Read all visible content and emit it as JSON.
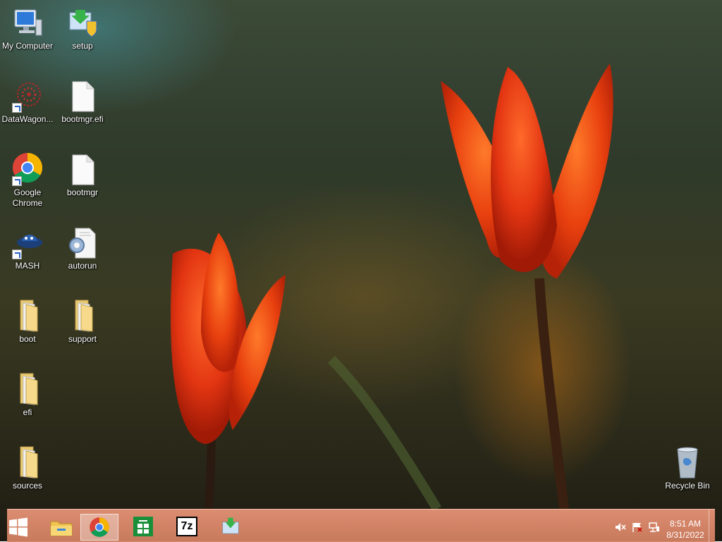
{
  "desktop": {
    "icons": [
      {
        "label": "My Computer",
        "icon": "computer-icon"
      },
      {
        "label": "setup",
        "icon": "setup-icon"
      },
      {
        "label": "DataWagon...",
        "icon": "datawagon-icon"
      },
      {
        "label": "bootmgr.efi",
        "icon": "file-icon"
      },
      {
        "label": "Google Chrome",
        "icon": "chrome-icon"
      },
      {
        "label": "bootmgr",
        "icon": "file-icon"
      },
      {
        "label": "MASH",
        "icon": "mash-icon"
      },
      {
        "label": "autorun",
        "icon": "settings-file-icon"
      },
      {
        "label": "boot",
        "icon": "folder-icon"
      },
      {
        "label": "support",
        "icon": "folder-icon"
      },
      {
        "label": "efi",
        "icon": "folder-icon"
      },
      {
        "label": "sources",
        "icon": "folder-icon"
      },
      {
        "label": "Recycle Bin",
        "icon": "recycle-bin-icon"
      }
    ]
  },
  "taskbar": {
    "start": "windows-logo-icon",
    "items": [
      {
        "name": "File Explorer",
        "icon": "file-explorer-icon"
      },
      {
        "name": "Google Chrome",
        "icon": "chrome-icon",
        "active": true
      },
      {
        "name": "Store",
        "icon": "store-icon"
      },
      {
        "name": "7-Zip",
        "icon": "7zip-icon",
        "text": "7z"
      },
      {
        "name": "setup",
        "icon": "setup-icon"
      }
    ],
    "tray": [
      "volume-muted-icon",
      "action-center-flag-icon",
      "network-icon"
    ],
    "clock": {
      "time": "8:51 AM",
      "date": "8/31/2022"
    }
  },
  "colors": {
    "taskbar": "#e0927a",
    "flower": "#e8400f"
  }
}
